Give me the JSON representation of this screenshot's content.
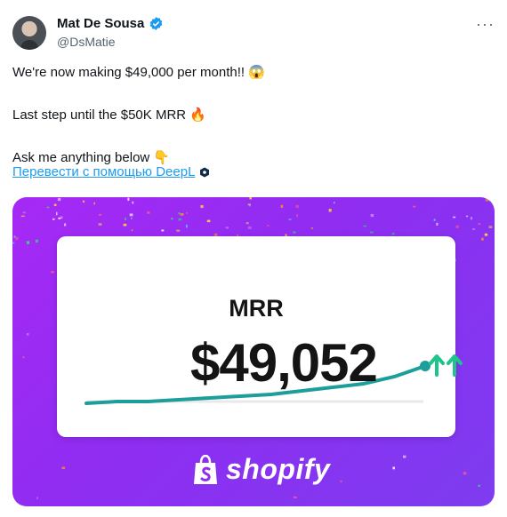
{
  "author": {
    "name": "Mat De Sousa",
    "handle": "@DsMatie",
    "avatar_icon": "profile-photo",
    "verified_color": "#1d9bf0"
  },
  "menu": {
    "more_label": "···"
  },
  "tweet": {
    "line1": "We're now making $49,000 per month!! 😱",
    "line2": "Last step until the $50K MRR 🔥",
    "line3": "Ask me anything below 👇",
    "translate_link": "Перевести с помощью DeepL"
  },
  "media": {
    "card_label": "MRR",
    "card_value": "$49,052",
    "trend_icon": "double-up-arrow-icon",
    "trend_color": "#1ec48c",
    "line_color": "#1e9e9a",
    "brand": "shopify"
  },
  "chart_data": {
    "type": "line",
    "title": "MRR",
    "y": [
      1,
      2,
      2,
      3,
      4,
      5,
      6,
      8,
      10,
      12,
      16,
      22
    ],
    "ylim": [
      0,
      30
    ]
  }
}
